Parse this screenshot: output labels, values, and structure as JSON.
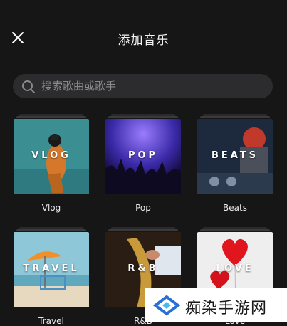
{
  "header": {
    "title": "添加音乐",
    "close_icon": "close-icon"
  },
  "search": {
    "placeholder": "搜索歌曲或歌手",
    "value": "",
    "icon": "search-icon"
  },
  "categories": [
    {
      "label": "VLOG",
      "name": "Vlog"
    },
    {
      "label": "POP",
      "name": "Pop"
    },
    {
      "label": "BEATS",
      "name": "Beats"
    },
    {
      "label": "TRAVEL",
      "name": "Travel"
    },
    {
      "label": "R&B",
      "name": "R&B"
    },
    {
      "label": "LOVE",
      "name": "Love"
    }
  ],
  "watermark": {
    "text": "痴染手游网",
    "color": "#2a6fd6"
  }
}
